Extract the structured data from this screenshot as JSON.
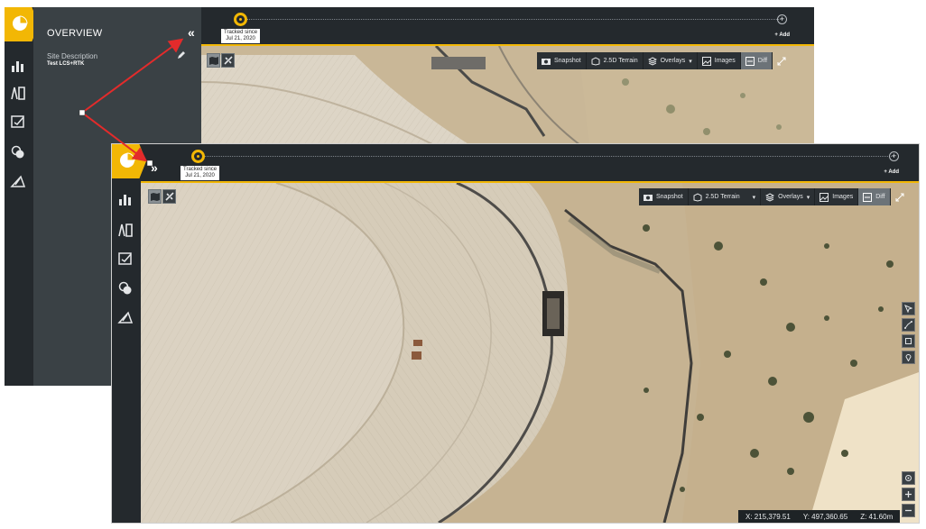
{
  "timeline": {
    "tracked_label": "Tracked since",
    "tracked_date": "Jul 21, 2020",
    "add_label": "+ Add"
  },
  "overview": {
    "title": "OVERVIEW",
    "collapse_glyph": "«",
    "site_description_label": "Site Description",
    "site_description_value": "Test LCS+RTK"
  },
  "sidebar": {
    "items": [
      "logo",
      "analytics",
      "reports",
      "checklist",
      "layers",
      "measure"
    ]
  },
  "expand_glyph": "»",
  "toolbar": {
    "snapshot": "Snapshot",
    "terrain": "2.5D Terrain",
    "overlays": "Overlays",
    "images": "Images",
    "diff": "Diff"
  },
  "coords": {
    "x": "X: 215,379.51",
    "y": "Y: 497,360.65",
    "z": "Z: 41.60m"
  },
  "colors": {
    "accent": "#f2b705",
    "panel": "#2a2f33",
    "arrow": "#e32b2b"
  },
  "icons": [
    "pie-chart-icon",
    "bar-chart-icon",
    "report-icon",
    "checklist-icon",
    "layers-icon",
    "measure-icon",
    "camera-icon",
    "terrain-icon",
    "overlays-icon",
    "images-icon",
    "diff-icon",
    "fullscreen-icon",
    "map-icon",
    "satellite-icon",
    "select-cursor-icon",
    "polyline-icon",
    "polygon-icon",
    "pin-icon",
    "locate-icon",
    "zoom-in-icon",
    "zoom-out-icon",
    "pencil-icon"
  ]
}
